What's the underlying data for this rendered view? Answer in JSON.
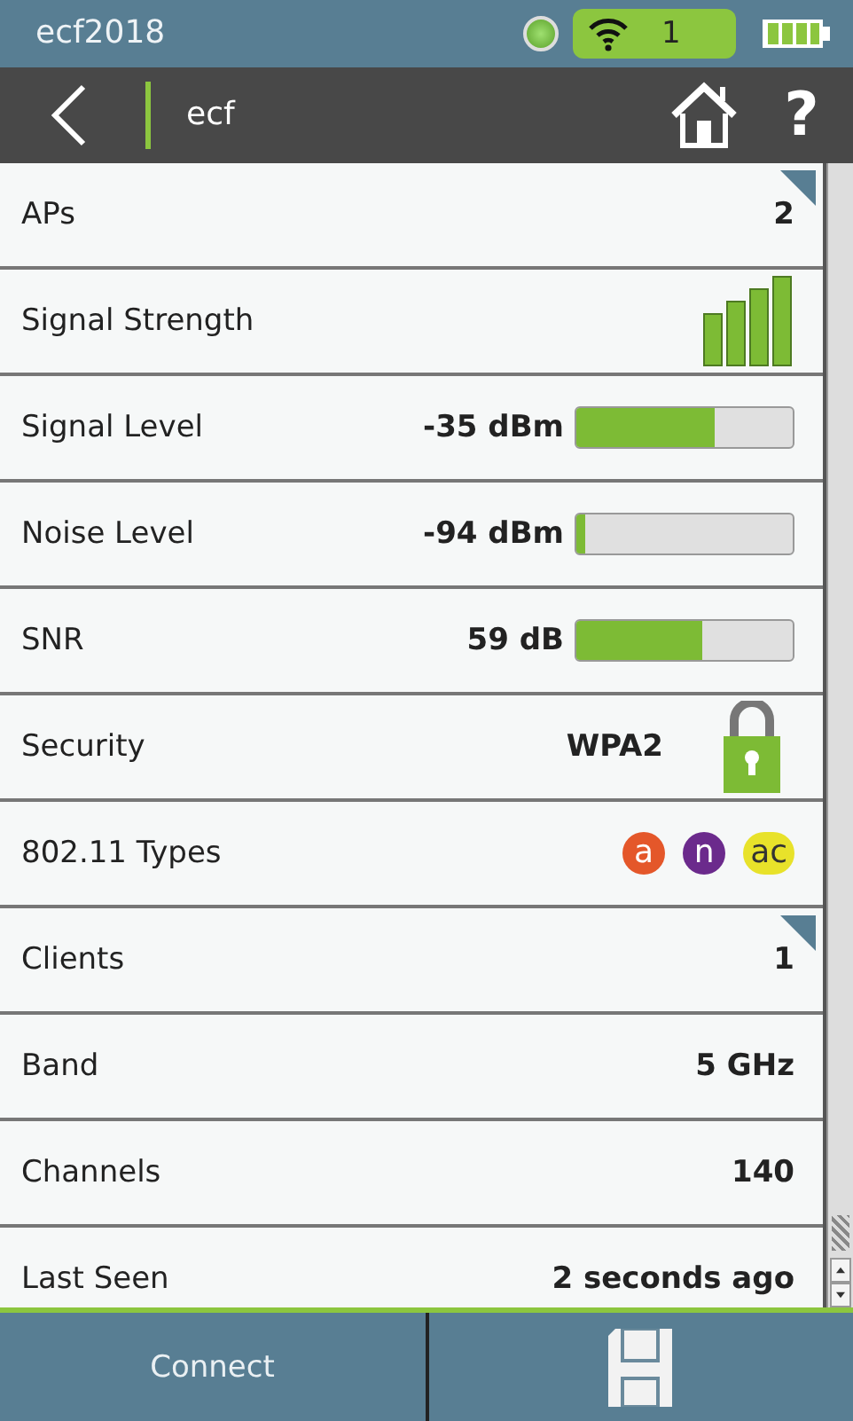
{
  "status_bar": {
    "title": "ecf2018",
    "wifi_count": "1"
  },
  "nav": {
    "title": "ecf",
    "help": "?"
  },
  "rows": [
    {
      "kind": "count",
      "label": "APs",
      "value": "2"
    },
    {
      "kind": "signal",
      "label": "Signal Strength"
    },
    {
      "kind": "meter",
      "label": "Signal Level",
      "value": "-35 dBm",
      "level": 0.64
    },
    {
      "kind": "meter",
      "label": "Noise Level",
      "value": "-94 dBm",
      "level": 0.04
    },
    {
      "kind": "meter",
      "label": "SNR",
      "value": "59 dB",
      "level": 0.58
    },
    {
      "kind": "security",
      "label": "Security",
      "value": "WPA2"
    },
    {
      "kind": "types",
      "label": "802.11 Types",
      "types": [
        {
          "label": "a",
          "color": "#e4572a"
        },
        {
          "label": "n",
          "color": "#6b2a8c"
        },
        {
          "label": "ac",
          "color": "#e8e22a"
        }
      ]
    },
    {
      "kind": "count",
      "label": "Clients",
      "value": "1"
    },
    {
      "kind": "text",
      "label": "Band",
      "value": "5 GHz"
    },
    {
      "kind": "text",
      "label": "Channels",
      "value": "140"
    },
    {
      "kind": "text",
      "label": "Last Seen",
      "value": "2  seconds ago"
    }
  ],
  "buttons": [
    {
      "kind": "text",
      "label": "Connect"
    },
    {
      "kind": "save"
    }
  ]
}
